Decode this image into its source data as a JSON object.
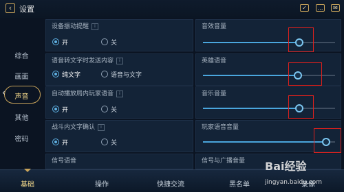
{
  "header": {
    "title": "设置",
    "icons": [
      "back-icon",
      "checklist-icon",
      "chat-icon",
      "mail-icon"
    ]
  },
  "sidebar": {
    "items": [
      {
        "label": "综合"
      },
      {
        "label": "画面"
      },
      {
        "label": "声音",
        "active": true
      },
      {
        "label": "其他"
      },
      {
        "label": "密码"
      }
    ]
  },
  "left_settings": [
    {
      "label": "设备振动提醒",
      "options": [
        "开",
        "关"
      ],
      "selected": 0
    },
    {
      "label": "语音转文字时发送内容",
      "options": [
        "纯文字",
        "语音与文字"
      ],
      "selected": 0
    },
    {
      "label": "自动播放局内玩家语音",
      "options": [
        "开",
        "关"
      ],
      "selected": 0
    },
    {
      "label": "战斗内文字确认",
      "options": [
        "开",
        "关"
      ],
      "selected": 0
    },
    {
      "label": "信号语音"
    }
  ],
  "right_settings": [
    {
      "label": "音效音量",
      "level": 0.73
    },
    {
      "label": "英雄语音",
      "level": 0.72
    },
    {
      "label": "音乐音量",
      "level": 0.73
    },
    {
      "label": "玩家语音音量",
      "level": 0.93
    },
    {
      "label": "信号与广播音量"
    }
  ],
  "bottom_tabs": [
    {
      "label": "基础",
      "active": true
    },
    {
      "label": "操作"
    },
    {
      "label": "快捷交流"
    },
    {
      "label": "黑名单"
    },
    {
      "label": "录像"
    }
  ],
  "watermark": {
    "text": "Bai经验",
    "sub": "jingyan.baidu.com"
  },
  "colors": {
    "accent": "#4aa6dd",
    "gold": "#c9a45a",
    "highlight": "#e0201c"
  }
}
